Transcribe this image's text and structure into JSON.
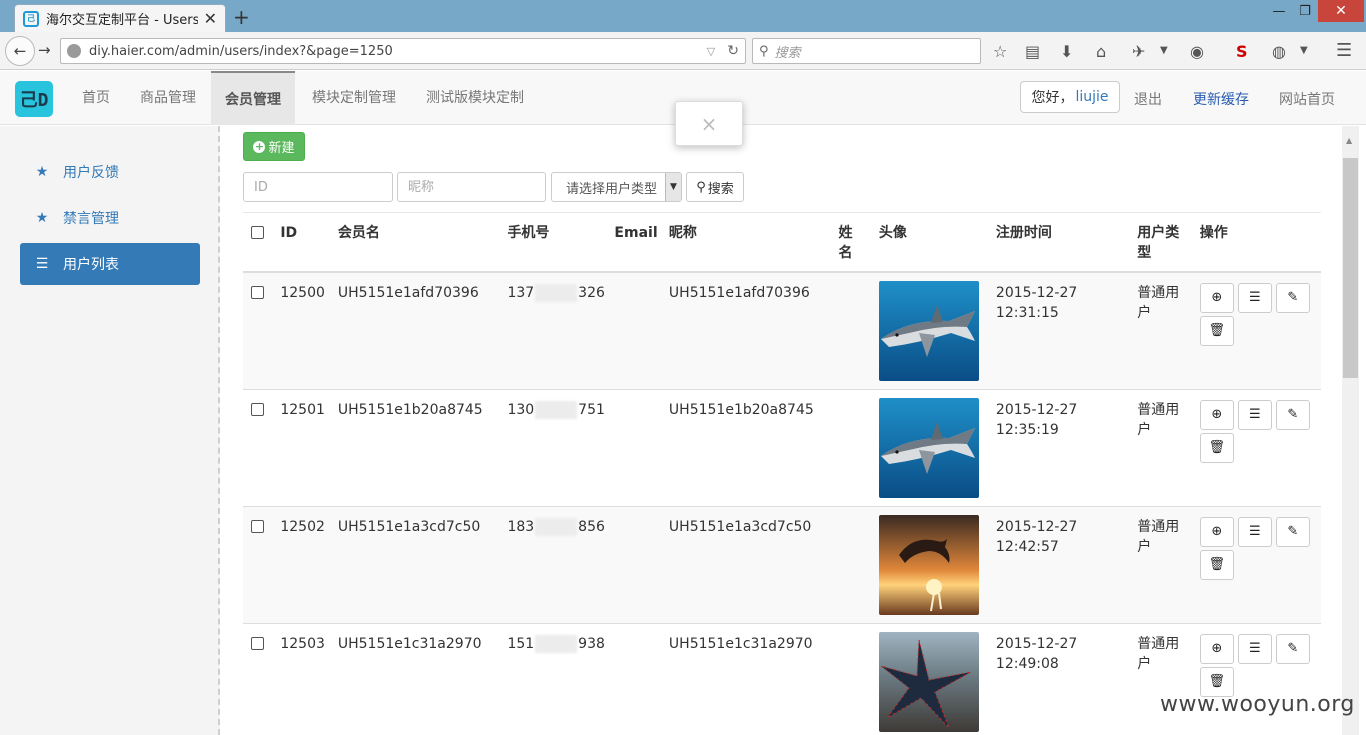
{
  "browser": {
    "tab_title": "海尔交互定制平台 - Users",
    "url": "diy.haier.com/admin/users/index?&page=1250",
    "search_placeholder": "搜索"
  },
  "header": {
    "logo_text": "己D",
    "menu": [
      {
        "label": "首页"
      },
      {
        "label": "商品管理"
      },
      {
        "label": "会员管理",
        "active": true
      },
      {
        "label": "模块定制管理"
      },
      {
        "label": "测试版模块定制"
      }
    ],
    "greeting_prefix": "您好，",
    "username": "liujie",
    "logout": "退出",
    "refresh_cache": "更新缓存",
    "site_home": "网站首页"
  },
  "sidebar": {
    "items": [
      {
        "label": "用户反馈",
        "icon": "star-icon"
      },
      {
        "label": "禁言管理",
        "icon": "star-icon"
      },
      {
        "label": "用户列表",
        "icon": "list-icon",
        "active": true
      }
    ]
  },
  "toolbar": {
    "new_label": "新建",
    "id_placeholder": "ID",
    "nickname_placeholder": "昵称",
    "user_type_select": "请选择用户类型",
    "search_label": "搜索"
  },
  "table": {
    "headers": {
      "id": "ID",
      "member_name": "会员名",
      "phone": "手机号",
      "email": "Email",
      "nickname": "昵称",
      "surname": "姓名",
      "avatar": "头像",
      "reg_time": "注册时间",
      "user_type": "用户类型",
      "actions": "操作"
    },
    "rows": [
      {
        "id": "12500",
        "member_name": "UH5151e1afd70396",
        "phone_prefix": "137",
        "phone_suffix": "326",
        "email": "",
        "nickname": "UH5151e1afd70396",
        "surname": "",
        "avatar": "shark",
        "reg_date": "2015-12-27",
        "reg_time": "12:31:15",
        "user_type": "普通用户"
      },
      {
        "id": "12501",
        "member_name": "UH5151e1b20a8745",
        "phone_prefix": "130",
        "phone_suffix": "751",
        "email": "",
        "nickname": "UH5151e1b20a8745",
        "surname": "",
        "avatar": "shark",
        "reg_date": "2015-12-27",
        "reg_time": "12:35:19",
        "user_type": "普通用户"
      },
      {
        "id": "12502",
        "member_name": "UH5151e1a3cd7c50",
        "phone_prefix": "183",
        "phone_suffix": "856",
        "email": "",
        "nickname": "UH5151e1a3cd7c50",
        "surname": "",
        "avatar": "dolphin",
        "reg_date": "2015-12-27",
        "reg_time": "12:42:57",
        "user_type": "普通用户"
      },
      {
        "id": "12503",
        "member_name": "UH5151e1c31a2970",
        "phone_prefix": "151",
        "phone_suffix": "938",
        "email": "",
        "nickname": "UH5151e1c31a2970",
        "surname": "",
        "avatar": "starfish",
        "reg_date": "2015-12-27",
        "reg_time": "12:49:08",
        "user_type": "普通用户"
      }
    ]
  },
  "toast": {
    "close_symbol": "×"
  },
  "watermark": "www.wooyun.org",
  "colors": {
    "primary": "#337ab7",
    "success": "#5cb85c",
    "titlebar": "#78a8c7",
    "logo": "#28c4de"
  }
}
